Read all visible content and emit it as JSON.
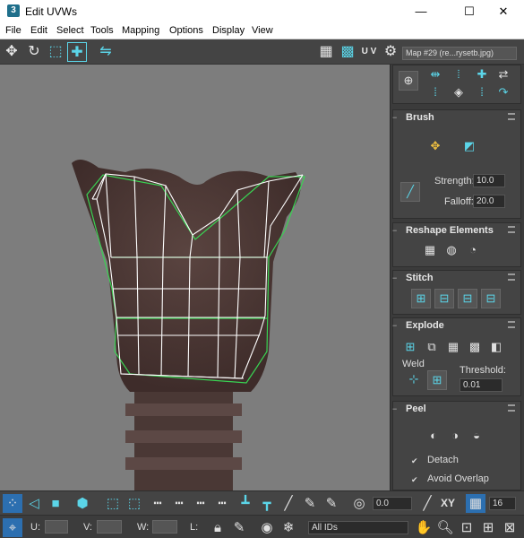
{
  "window": {
    "app_icon": "3",
    "title": "Edit UVWs",
    "minimize": "—",
    "maximize": "☐",
    "close": "✕"
  },
  "menu": {
    "items": [
      "File",
      "Edit",
      "Select",
      "Tools",
      "Mapping",
      "Options",
      "Display",
      "View"
    ]
  },
  "toolbar": {
    "uv_label": "U V",
    "map_dropdown": "Map #29 (re...rysetb.jpg)"
  },
  "panel": {
    "brush": {
      "title": "Brush",
      "strength_label": "Strength:",
      "strength_value": "10.0",
      "falloff_label": "Falloff:",
      "falloff_value": "20.0"
    },
    "reshape": {
      "title": "Reshape Elements"
    },
    "stitch": {
      "title": "Stitch"
    },
    "explode": {
      "title": "Explode",
      "weld_label": "Weld",
      "threshold_label": "Threshold:",
      "threshold_value": "0.01"
    },
    "peel": {
      "title": "Peel",
      "detach_label": "Detach",
      "avoid_overlap_label": "Avoid Overlap"
    }
  },
  "status": {
    "angle_value": "0.0",
    "xy_label": "XY",
    "grid_value": "16",
    "u_label": "U:",
    "v_label": "V:",
    "w_label": "W:",
    "l_label": "L:",
    "ids_value": "All IDs"
  },
  "colors": {
    "accent": "#5bd5e8",
    "selection_green": "#39d353",
    "viewport_bg": "#7d7d7d",
    "panel_bg": "#3b3b3b"
  }
}
